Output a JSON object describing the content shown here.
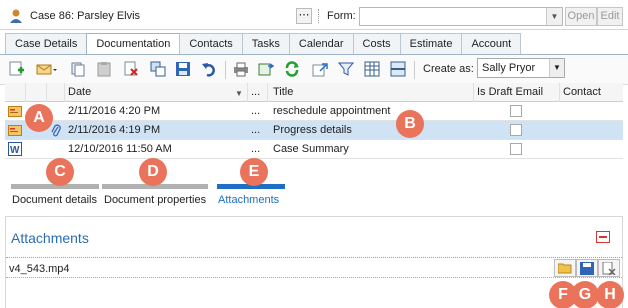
{
  "header": {
    "case_label": "Case  86: Parsley Elvis",
    "dots": "⋯",
    "form_label": "Form:",
    "open_label": "Open",
    "edit_label": "Edit"
  },
  "tabs": [
    {
      "label": "Case Details",
      "active": false
    },
    {
      "label": "Documentation",
      "active": true
    },
    {
      "label": "Contacts",
      "active": false
    },
    {
      "label": "Tasks",
      "active": false
    },
    {
      "label": "Calendar",
      "active": false
    },
    {
      "label": "Costs",
      "active": false
    },
    {
      "label": "Estimate",
      "active": false
    },
    {
      "label": "Account",
      "active": false
    }
  ],
  "toolbar": {
    "create_as_label": "Create as:",
    "create_as_value": "Sally Pryor"
  },
  "grid": {
    "headers": {
      "date": "Date",
      "dots": "...",
      "title": "Title",
      "draft": "Is Draft Email",
      "contact": "Contact"
    },
    "rows": [
      {
        "date": "2/11/2016 4:20 PM",
        "dots": "...",
        "title": "reschedule appointment",
        "selected": false
      },
      {
        "date": "2/11/2016 4:19 PM",
        "dots": "...",
        "title": "Progress details",
        "selected": true
      },
      {
        "date": "12/10/2016 11:50 AM",
        "dots": "...",
        "title": "Case Summary",
        "selected": false
      }
    ]
  },
  "sections": {
    "document_details": "Document details",
    "document_properties": "Document properties",
    "attachments": "Attachments"
  },
  "attachments": {
    "title": "Attachments",
    "file_name": "v4_543.mp4"
  },
  "markers": [
    "A",
    "B",
    "C",
    "D",
    "E",
    "F",
    "G",
    "H"
  ],
  "colors": {
    "accent": "#2a6db3",
    "marker": "#e9745b",
    "selected_row": "#cfe3f5"
  }
}
